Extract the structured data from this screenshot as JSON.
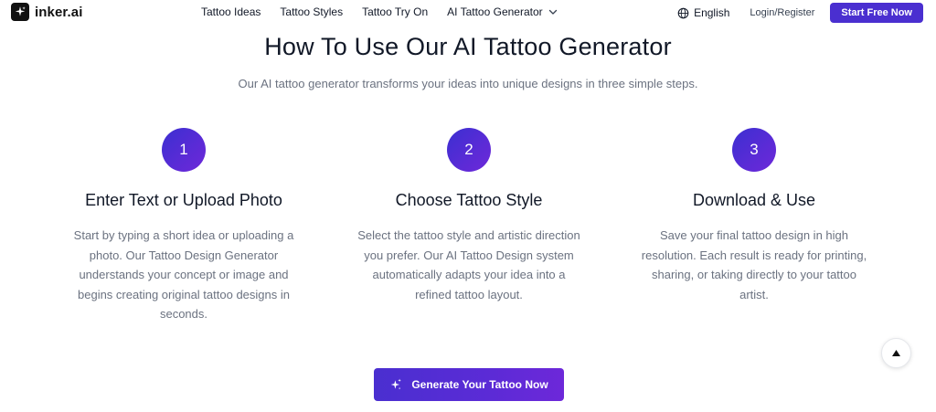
{
  "header": {
    "logo_text": "inker.ai",
    "nav": [
      {
        "label": "Tattoo Ideas"
      },
      {
        "label": "Tattoo Styles"
      },
      {
        "label": "Tattoo Try On"
      },
      {
        "label": "AI Tattoo Generator",
        "has_dropdown": true,
        "icon": "chevron-down-icon"
      }
    ],
    "language": "English",
    "login": "Login/Register",
    "cta": "Start Free Now"
  },
  "section": {
    "title": "How To Use Our AI Tattoo Generator",
    "subtitle": "Our AI tattoo generator transforms your ideas into unique designs in three simple steps.",
    "steps": [
      {
        "number": "1",
        "title": "Enter Text or Upload Photo",
        "description": "Start by typing a short idea or uploading a photo. Our Tattoo Design Generator understands your concept or image and begins creating original tattoo designs in seconds."
      },
      {
        "number": "2",
        "title": "Choose Tattoo Style",
        "description": "Select the tattoo style and artistic direction you prefer. Our AI Tattoo Design system automatically adapts your idea into a refined tattoo layout."
      },
      {
        "number": "3",
        "title": "Download & Use",
        "description": "Save your final tattoo design in high resolution. Each result is ready for printing, sharing, or taking directly to your tattoo artist."
      }
    ],
    "cta_label": "Generate Your Tattoo Now"
  },
  "colors": {
    "brand": "#4a2fd0",
    "gradient_end": "#6d28d9",
    "muted_text": "#6b7280"
  },
  "icons": {
    "logo": "sparkle-logo-icon",
    "language": "globe-icon",
    "cta": "sparkle-icon",
    "scroll_top": "arrow-up-icon"
  }
}
